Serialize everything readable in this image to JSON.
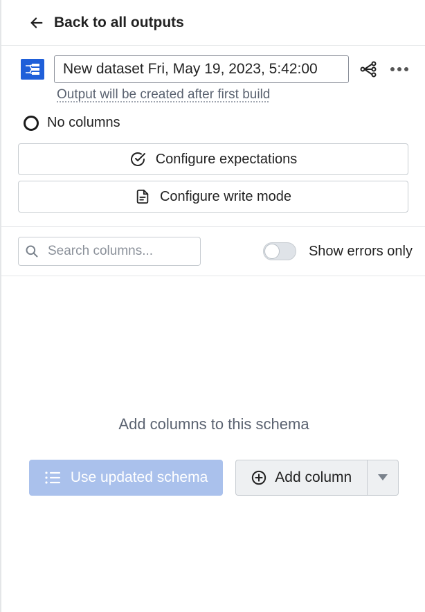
{
  "header": {
    "back_label": "Back to all outputs"
  },
  "dataset": {
    "name": "New dataset Fri, May 19, 2023, 5:42:00",
    "build_note": "Output will be created after first build"
  },
  "columns": {
    "status_label": "No columns"
  },
  "buttons": {
    "configure_expectations": "Configure expectations",
    "configure_write_mode": "Configure write mode"
  },
  "search": {
    "placeholder": "Search columns..."
  },
  "toggle": {
    "show_errors_label": "Show errors only",
    "show_errors_on": false
  },
  "empty": {
    "title": "Add columns to this schema",
    "use_schema_label": "Use updated schema",
    "add_column_label": "Add column"
  }
}
